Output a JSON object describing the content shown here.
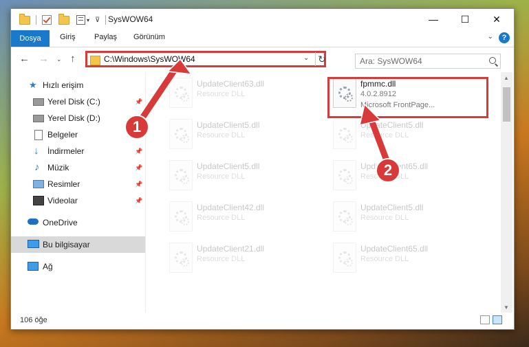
{
  "window": {
    "title": "SysWOW64",
    "controls": {
      "minimize": "—",
      "maximize": "☐",
      "close": "✕"
    }
  },
  "ribbon": {
    "file_tab": "Dosya",
    "tabs": [
      "Giriş",
      "Paylaş",
      "Görünüm"
    ],
    "help": "?"
  },
  "address": {
    "path": "C:\\Windows\\SysWOW64",
    "search_placeholder": "Ara: SysWOW64"
  },
  "sidebar": {
    "items": [
      {
        "label": "Hızlı erişim",
        "icon": "star-icon"
      },
      {
        "label": "Yerel Disk (C:)",
        "icon": "drive-icon",
        "pinned": true
      },
      {
        "label": "Yerel Disk (D:)",
        "icon": "drive-icon"
      },
      {
        "label": "Belgeler",
        "icon": "documents-icon"
      },
      {
        "label": "İndirmeler",
        "icon": "download-icon",
        "pinned": true
      },
      {
        "label": "Müzik",
        "icon": "music-icon",
        "pinned": true
      },
      {
        "label": "Resimler",
        "icon": "pictures-icon",
        "pinned": true
      },
      {
        "label": "Videolar",
        "icon": "videos-icon",
        "pinned": true
      },
      {
        "label": "OneDrive",
        "icon": "cloud-icon"
      },
      {
        "label": "Bu bilgisayar",
        "icon": "computer-icon",
        "selected": true
      },
      {
        "label": "Ağ",
        "icon": "network-icon"
      }
    ]
  },
  "files": {
    "highlighted": {
      "name": "fpmmc.dll",
      "version": "4.0.2.8912",
      "description": "Microsoft FrontPage..."
    },
    "faded": [
      {
        "name": "UpdateClient63.dll",
        "type": "Resource DLL"
      },
      {
        "name": "UpdateClient5.dll",
        "type": "Resource DLL"
      },
      {
        "name": "UpdateClient5.dll",
        "type": "Resource DLL"
      },
      {
        "name": "UpdateClient5.dll",
        "type": "Resource DLL"
      },
      {
        "name": "UpdateClient65.dll",
        "type": "Resource DLL"
      },
      {
        "name": "UpdateClient42.dll",
        "type": "Resource DLL"
      },
      {
        "name": "UpdateClient5.dll",
        "type": "Resource DLL"
      },
      {
        "name": "UpdateClient21.dll",
        "type": "Resource DLL"
      },
      {
        "name": "UpdateClient65.dll",
        "type": "Resource DLL"
      }
    ]
  },
  "status": {
    "item_count": "106 öğe"
  },
  "callouts": [
    "1",
    "2"
  ],
  "colors": {
    "accent": "#1979ca",
    "highlight": "#d83a3a"
  }
}
